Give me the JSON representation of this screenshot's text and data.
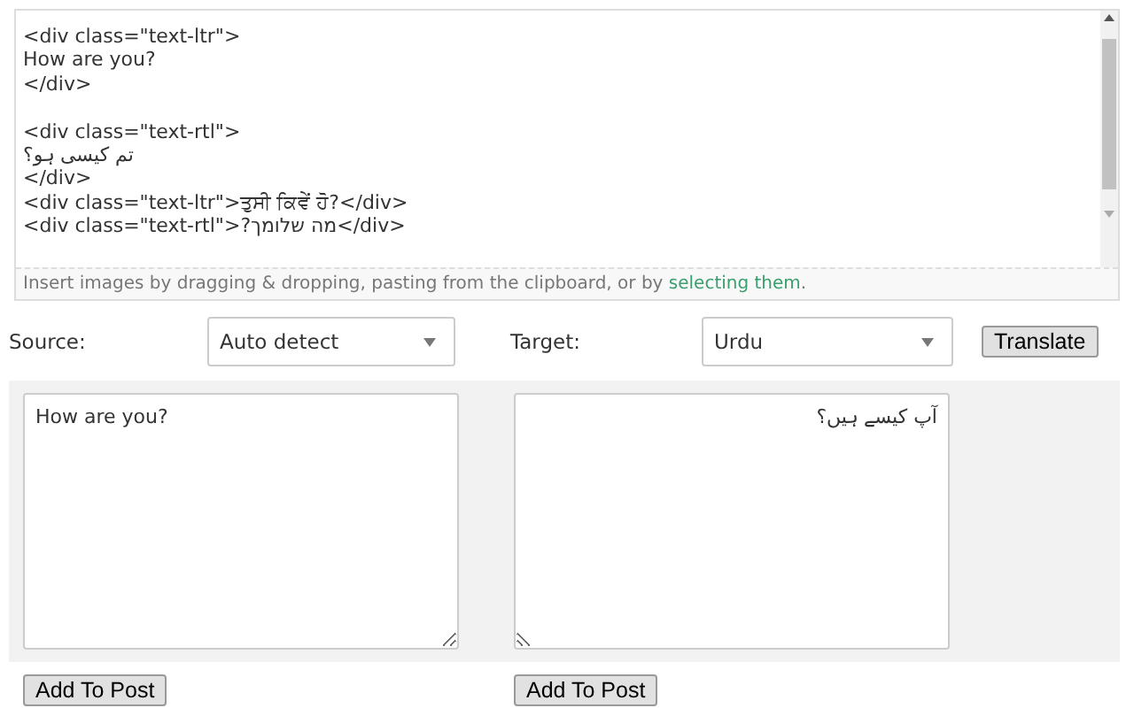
{
  "editor": {
    "value": "<div class=\"text-ltr\">\nHow are you?\n</div>\n\n<div class=\"text-rtl\">\nتم کیسی ہو؟\n</div>\n<div class=\"text-ltr\">ਤੁਸੀ ਕਿਵੇਂ ਹੋ?</div>\n<div class=\"text-rtl\">?מה שלומך</div>",
    "hint": "Insert images by dragging & dropping, pasting from the clipboard, or by ",
    "hint_link": "selecting them",
    "hint_end": "."
  },
  "source": {
    "label": "Source:",
    "value": "Auto detect"
  },
  "target": {
    "label": "Target:",
    "value": "Urdu"
  },
  "translate_button": "Translate",
  "panels": [
    {
      "value": "How are you?",
      "kind": "source",
      "button": "Add To Post"
    },
    {
      "value": "آپ کیسے ہیں؟",
      "kind": "translated",
      "button": "Add To Post"
    }
  ]
}
